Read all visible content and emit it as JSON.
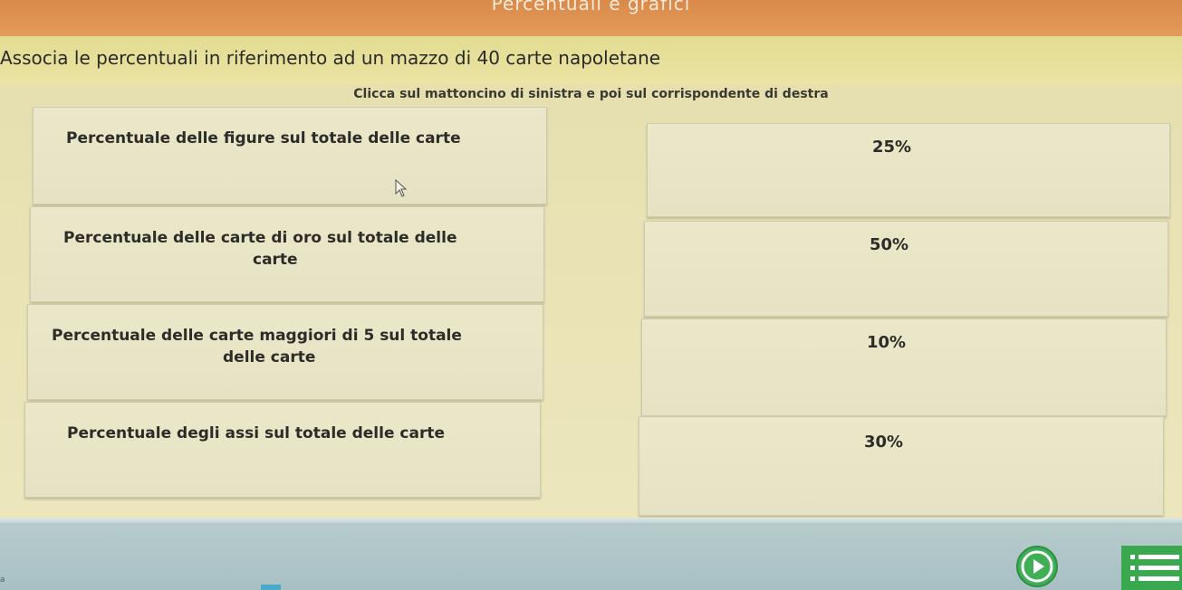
{
  "window": {
    "title": "Percentuali e grafici"
  },
  "exercise": {
    "title": "Associa le percentuali in riferimento ad un mazzo di 40 carte napoletane",
    "instruction": "Clicca sul mattoncino di sinistra e poi sul corrispondente di destra"
  },
  "left_cards": [
    {
      "lines": [
        "Percentuale delle figure sul totale delle carte"
      ]
    },
    {
      "lines": [
        "Percentuale delle carte di oro sul totale delle",
        "carte"
      ]
    },
    {
      "lines": [
        "Percentuale delle carte maggiori di 5 sul totale",
        "delle carte"
      ]
    },
    {
      "lines": [
        "Percentuale degli assi sul totale delle carte"
      ]
    }
  ],
  "right_cards": [
    {
      "label": "25%"
    },
    {
      "label": "50%"
    },
    {
      "label": "10%"
    },
    {
      "label": "30%"
    }
  ],
  "footer": {
    "corner_mark": "a"
  },
  "icons": {
    "play": "play-icon",
    "menu": "list-menu-icon",
    "cursor": "mouse-pointer-icon"
  },
  "colors": {
    "top_bar": "#e0914f",
    "header_bar": "#e6df9a",
    "card": "#e9e5c7",
    "button_green": "#3fae55"
  }
}
